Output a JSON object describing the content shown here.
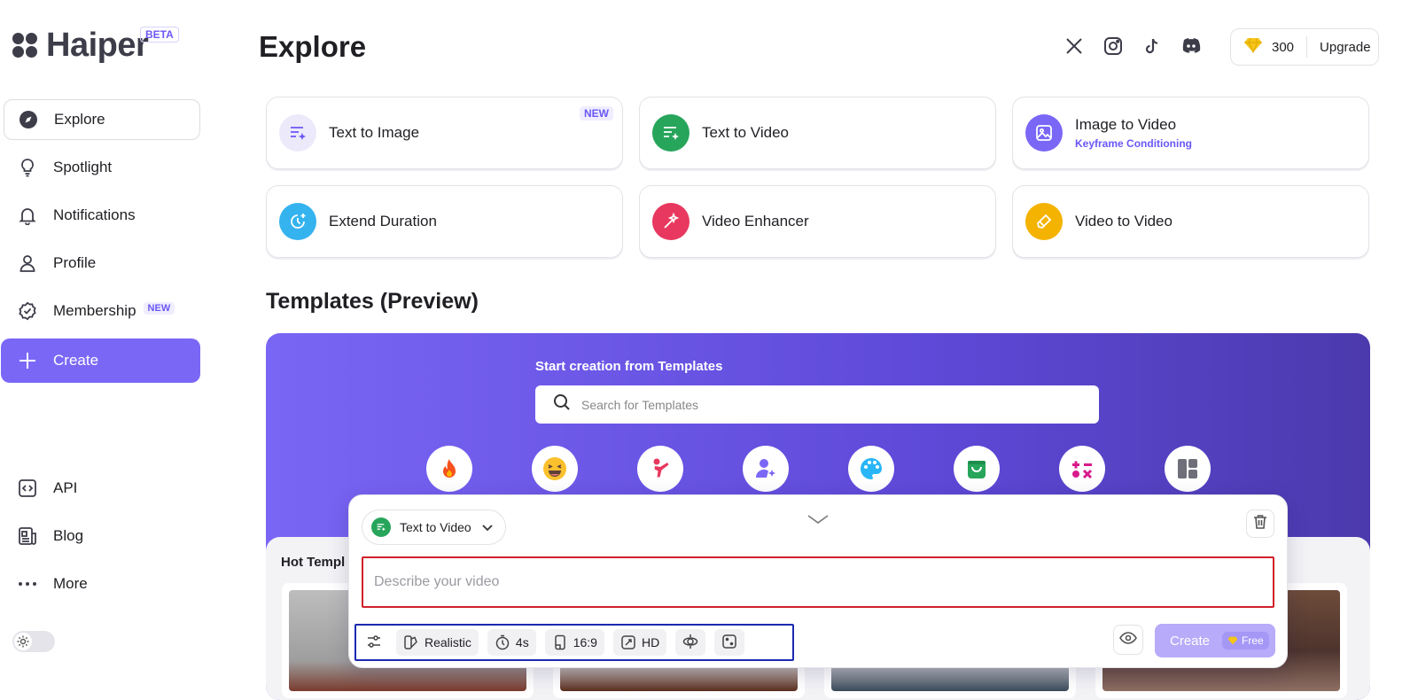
{
  "brand": {
    "name": "Haiper",
    "badge": "BETA"
  },
  "nav": {
    "items": [
      {
        "label": "Explore",
        "icon": "compass-icon",
        "active": true
      },
      {
        "label": "Spotlight",
        "icon": "lightbulb-icon"
      },
      {
        "label": "Notifications",
        "icon": "bell-icon"
      },
      {
        "label": "Profile",
        "icon": "user-icon"
      },
      {
        "label": "Membership",
        "icon": "badge-check-icon",
        "tag": "NEW"
      },
      {
        "label": "Create",
        "icon": "plus-icon"
      }
    ],
    "bottom": [
      {
        "label": "API",
        "icon": "code-icon"
      },
      {
        "label": "Blog",
        "icon": "newspaper-icon"
      },
      {
        "label": "More",
        "icon": "dots-icon"
      }
    ]
  },
  "header": {
    "title": "Explore",
    "socials": [
      "x-icon",
      "instagram-icon",
      "tiktok-icon",
      "discord-icon"
    ],
    "credits": "300",
    "upgrade_label": "Upgrade"
  },
  "tools": [
    {
      "label": "Text to Image",
      "tag": "NEW",
      "color": "#ece9fb"
    },
    {
      "label": "Text to Video",
      "color": "#27a55b"
    },
    {
      "label": "Image to Video",
      "sub": "Keyframe Conditioning",
      "color": "#7b67f6"
    },
    {
      "label": "Extend Duration",
      "color": "#35b3ef"
    },
    {
      "label": "Video Enhancer",
      "color": "#e8385f"
    },
    {
      "label": "Video to Video",
      "color": "#f4b300"
    }
  ],
  "templates": {
    "section_title": "Templates (Preview)",
    "caption": "Start creation from Templates",
    "search_placeholder": "Search for Templates",
    "categories": [
      "fire-icon",
      "laugh-emoji-icon",
      "dance-figure-icon",
      "user-sparkle-icon",
      "palette-icon",
      "shopping-bag-icon",
      "shapes-icon",
      "layout-grid-icon"
    ],
    "hot_title": "Hot Templ"
  },
  "composer": {
    "mode_label": "Text to Video",
    "prompt_placeholder": "Describe your video",
    "style_label": "Realistic",
    "duration_label": "4s",
    "ratio_label": "16:9",
    "quality_label": "HD",
    "create_label": "Create",
    "free_label": "Free"
  }
}
